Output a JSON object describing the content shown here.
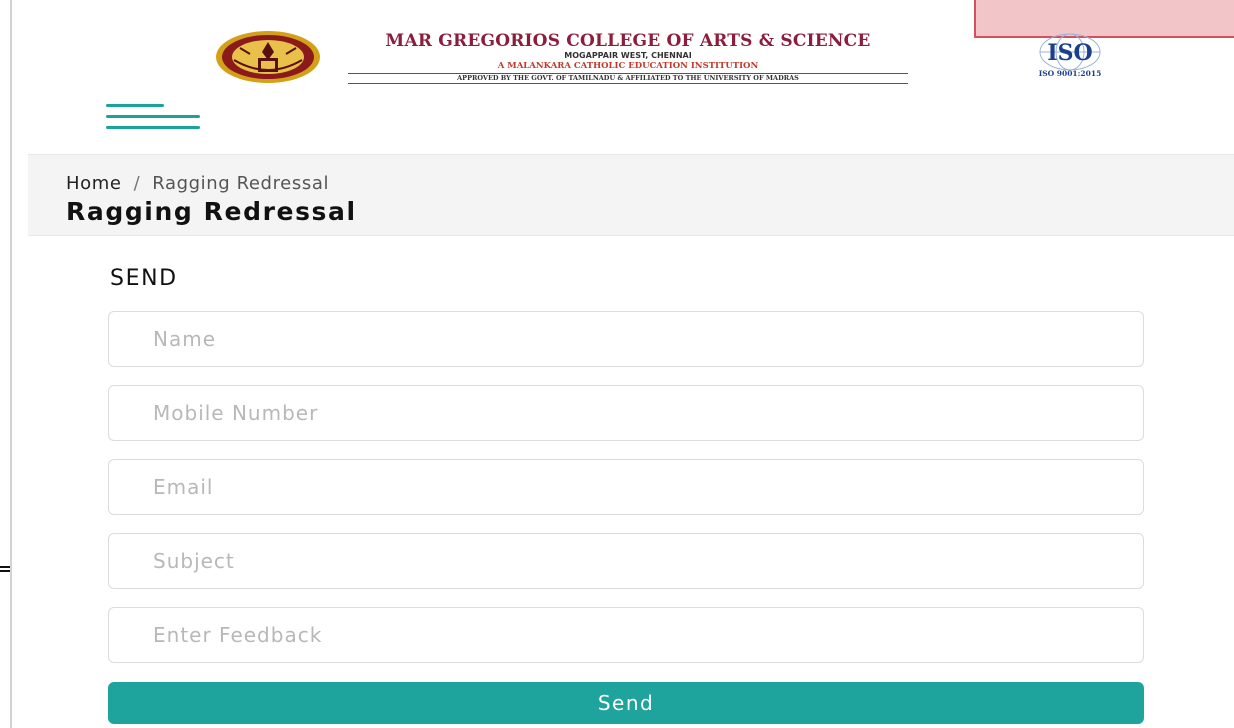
{
  "header": {
    "college_name": "MAR GREGORIOS COLLEGE OF ARTS & SCIENCE",
    "location": "MOGAPPAIR WEST, CHENNAI",
    "tagline": "A MALANKARA CATHOLIC EDUCATION INSTITUTION",
    "approval": "APPROVED BY THE GOVT. OF TAMILNADU & AFFILIATED TO THE UNIVERSITY OF MADRAS",
    "iso_label": "ISO",
    "iso_cert": "ISO 9001:2015"
  },
  "breadcrumb": {
    "home": "Home",
    "separator": "/",
    "current": "Ragging Redressal"
  },
  "page_title": "Ragging Redressal",
  "form": {
    "heading": "SEND",
    "name_placeholder": "Name",
    "mobile_placeholder": "Mobile Number",
    "email_placeholder": "Email",
    "subject_placeholder": "Subject",
    "feedback_placeholder": "Enter Feedback",
    "submit_label": "Send"
  },
  "colors": {
    "accent": "#1fa39d",
    "brand": "#8b1e3f",
    "band": "#f4f4f4"
  },
  "icons": {
    "menu": "hamburger-icon",
    "crest": "college-crest-logo",
    "iso": "iso-logo"
  }
}
